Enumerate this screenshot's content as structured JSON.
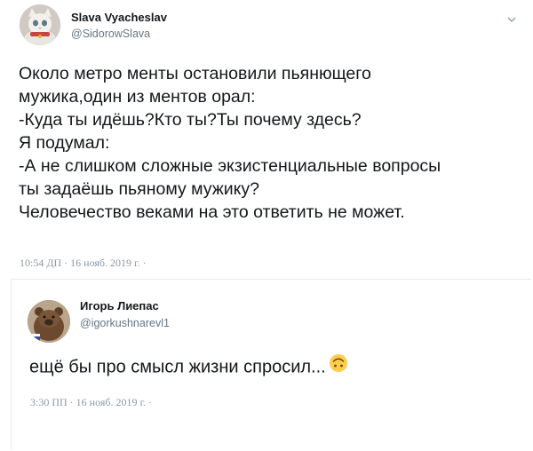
{
  "tweet": {
    "author_name": "Slava Vyacheslav",
    "author_handle": "@SidorowSlava",
    "lines": [
      "Около метро менты остановили пьянющего",
      "мужика,один из ментов орал:",
      "-Куда ты идёшь?Кто ты?Ты почему здесь?",
      "Я подумал:",
      "-А не слишком сложные экзистенциальные вопросы",
      "ты задаёшь пьяному мужику?",
      "Человечество веками на это ответить не может."
    ],
    "timestamp": "10:54 ДП · 16 нояб. 2019 г. ·"
  },
  "reply": {
    "author_name": "Игорь Лиепас",
    "author_handle": "@igorkushnarevl1",
    "text": "ещё бы про смысл жизни спросил...",
    "emoji_icon": "upside-down-face-icon",
    "timestamp": "3:30 ПП · 16 нояб. 2019 г. ·"
  }
}
